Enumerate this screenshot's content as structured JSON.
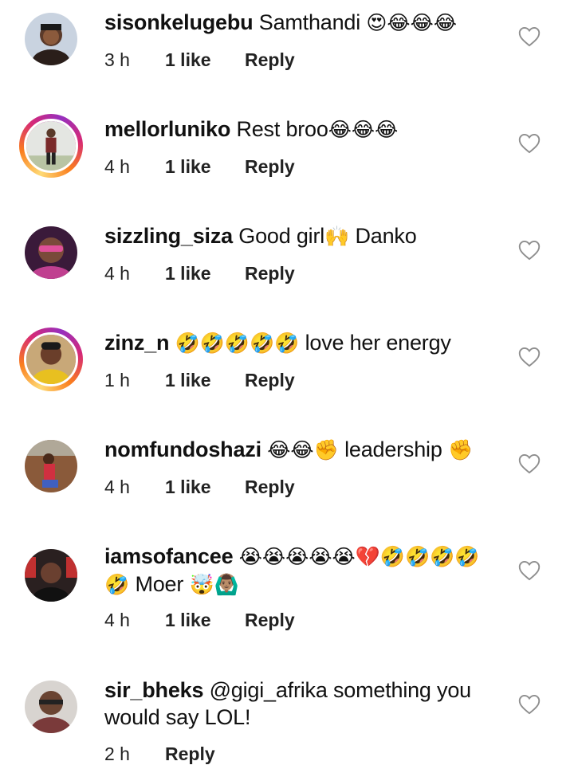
{
  "comments": [
    {
      "username": "sisonkelugebu",
      "text": "Samthandi",
      "emojis": "😍😂😂😂",
      "time": "3 h",
      "likes": "1 like",
      "reply": "Reply"
    },
    {
      "username": "mellorluniko",
      "text": "Rest broo",
      "emojis": "😂😂😂",
      "time": "4 h",
      "likes": "1 like",
      "reply": "Reply"
    },
    {
      "username": "sizzling_siza",
      "text": "Good girl",
      "emojis": "🙌",
      "text2": "Danko",
      "time": "4 h",
      "likes": "1 like",
      "reply": "Reply"
    },
    {
      "username": "zinz_n",
      "emojis": "🤣🤣🤣🤣🤣",
      "text": "love her energy",
      "time": "1 h",
      "likes": "1 like",
      "reply": "Reply"
    },
    {
      "username": "nomfundoshazi",
      "emojis": "😂😂✊",
      "text": "leadership",
      "emojis2": "✊",
      "time": "4 h",
      "likes": "1 like",
      "reply": "Reply"
    },
    {
      "username": "iamsofancee",
      "emojis": "😭😭😭😭😭💔🤣🤣🤣🤣🤣",
      "text": "Moer",
      "emojis2": "🤯🙆🏽‍♂️",
      "time": "4 h",
      "likes": "1 like",
      "reply": "Reply"
    },
    {
      "username": "sir_bheks",
      "text": "@gigi_afrika something you would say LOL!",
      "time": "2 h",
      "reply": "Reply"
    }
  ],
  "icons": {
    "like": "heart-outline-icon"
  },
  "colors": {
    "story_ring_start": "#feda75",
    "story_ring_mid": "#d62976",
    "meta_text": "#222222",
    "heart_stroke": "#8e8e8e"
  }
}
